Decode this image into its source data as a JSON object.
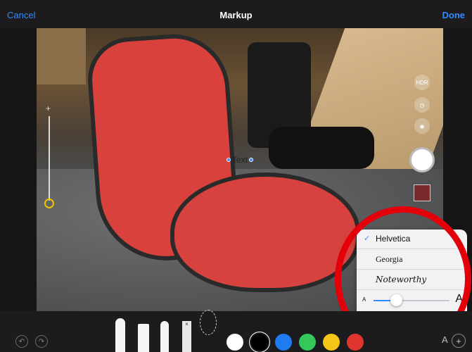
{
  "topbar": {
    "cancel": "Cancel",
    "title": "Markup",
    "done": "Done"
  },
  "camera": {
    "hdr_label": "HDR",
    "zoom_plus": "+"
  },
  "annotation": {
    "text": "Text"
  },
  "font_popover": {
    "fonts": [
      {
        "label": "Helvetica",
        "selected": true
      },
      {
        "label": "Georgia",
        "selected": false
      },
      {
        "label": "Noteworthy",
        "selected": false
      }
    ],
    "size_small_label": "A",
    "size_large_label": "A",
    "size_level_fraction": 0.3,
    "alignment_options": [
      "left",
      "center",
      "right"
    ],
    "alignment_selected": "center"
  },
  "toolbar": {
    "tools": [
      "pen-icon",
      "marker-icon",
      "pencil-icon",
      "eraser-icon",
      "lasso-icon"
    ],
    "eraser_mark": "×",
    "colors": [
      "#ffffff",
      "#000000",
      "#1e7bf0",
      "#34c759",
      "#f5c518",
      "#e0342f"
    ],
    "selected_color": "#000000",
    "text_tool_label": "A",
    "add_label": "+"
  }
}
